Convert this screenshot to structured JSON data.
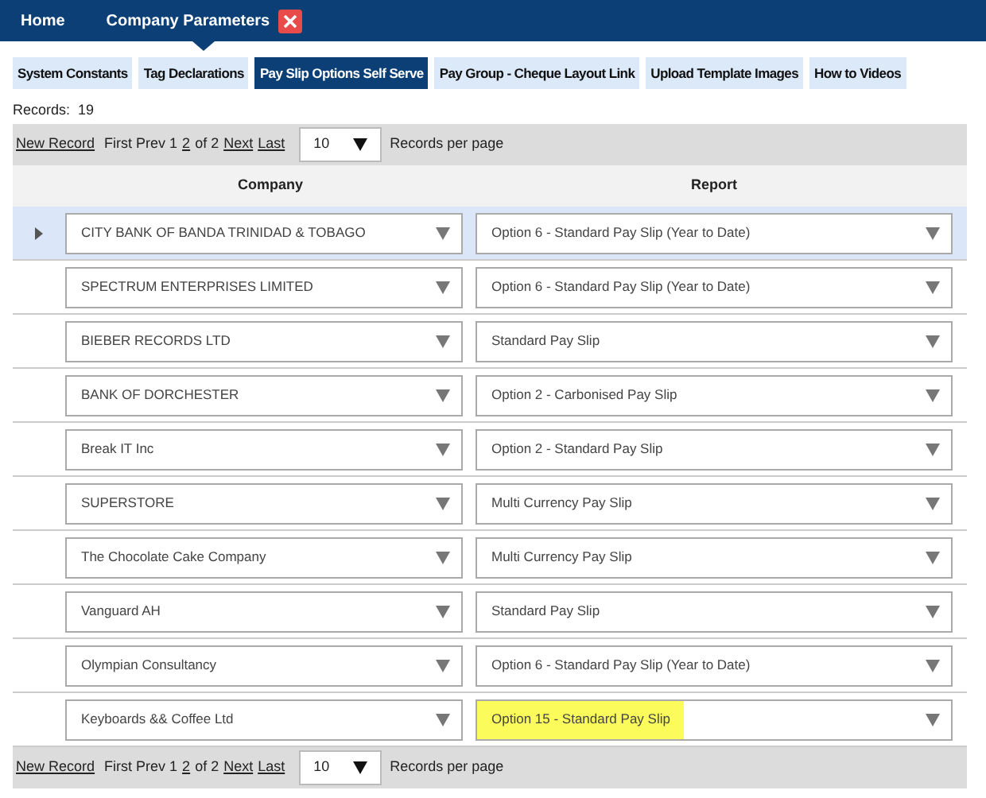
{
  "top_bar": {
    "items": [
      {
        "label": "Home",
        "selected": false,
        "closable": false
      },
      {
        "label": "Company Parameters",
        "selected": true,
        "closable": true
      }
    ]
  },
  "tabs": [
    {
      "label": "System Constants",
      "selected": false
    },
    {
      "label": "Tag Declarations",
      "selected": false
    },
    {
      "label": "Pay Slip Options Self Serve",
      "selected": true
    },
    {
      "label": "Pay Group - Cheque Layout Link",
      "selected": false
    },
    {
      "label": "Upload Template Images",
      "selected": false
    },
    {
      "label": "How to Videos",
      "selected": false
    }
  ],
  "records_label": "Records:  19",
  "pager_top": {
    "items": [
      {
        "text": "New Record",
        "link": true
      },
      {
        "text": "First Prev 1",
        "link": false
      },
      {
        "text": "2",
        "link": true
      },
      {
        "text": "of 2",
        "link": false
      },
      {
        "text": "Next",
        "link": true
      },
      {
        "text": "Last",
        "link": true
      }
    ],
    "page_size": "10",
    "per_page_label": "Records per page"
  },
  "table": {
    "columns": [
      "Company",
      "Report"
    ],
    "rows": [
      {
        "selected": true,
        "company": "CITY BANK OF BANDA TRINIDAD & TOBAGO",
        "report": "Option 6 - Standard Pay Slip (Year to Date)",
        "highlighted": false
      },
      {
        "selected": false,
        "company": "SPECTRUM ENTERPRISES LIMITED",
        "report": "Option 6 - Standard Pay Slip (Year to Date)",
        "highlighted": false
      },
      {
        "selected": false,
        "company": "BIEBER RECORDS LTD",
        "report": "Standard Pay Slip",
        "highlighted": false
      },
      {
        "selected": false,
        "company": "BANK OF DORCHESTER",
        "report": "Option 2 - Carbonised Pay Slip",
        "highlighted": false
      },
      {
        "selected": false,
        "company": "Break IT Inc",
        "report": "Option 2 - Standard Pay Slip",
        "highlighted": false
      },
      {
        "selected": false,
        "company": "SUPERSTORE",
        "report": "Multi Currency Pay Slip",
        "highlighted": false
      },
      {
        "selected": false,
        "company": "The Chocolate Cake Company",
        "report": "Multi Currency Pay Slip",
        "highlighted": false
      },
      {
        "selected": false,
        "company": "Vanguard AH",
        "report": "Standard Pay Slip",
        "highlighted": false
      },
      {
        "selected": false,
        "company": "Olympian Consultancy",
        "report": "Option 6 - Standard Pay Slip (Year to Date)",
        "highlighted": false
      },
      {
        "selected": false,
        "company": "Keyboards && Coffee Ltd",
        "report": "Option 15 - Standard Pay Slip",
        "highlighted": true
      }
    ]
  },
  "pager_bottom": {
    "items": [
      {
        "text": "New Record",
        "link": true
      },
      {
        "text": "First Prev 1",
        "link": false
      },
      {
        "text": "2",
        "link": true
      },
      {
        "text": "of 2",
        "link": false
      },
      {
        "text": "Next",
        "link": true
      },
      {
        "text": "Last",
        "link": true
      }
    ],
    "page_size": "10",
    "per_page_label": "Records per page"
  }
}
